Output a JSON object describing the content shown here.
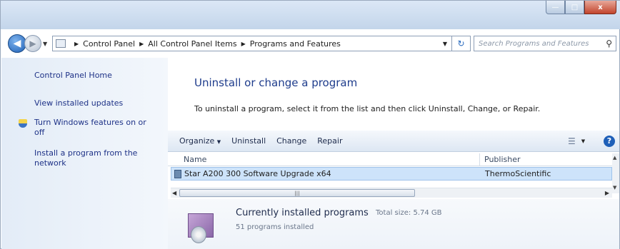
{
  "window": {
    "caption_buttons": {
      "minimize": "—",
      "maximize": "□",
      "close": "x"
    }
  },
  "navigation": {
    "breadcrumbs": [
      "Control Panel",
      "All Control Panel Items",
      "Programs and Features"
    ],
    "search_placeholder": "Search Programs and Features"
  },
  "sidebar": {
    "items": [
      {
        "label": "Control Panel Home"
      },
      {
        "label": "View installed updates"
      },
      {
        "label": "Turn Windows features on or off"
      },
      {
        "label": "Install a program from the network"
      }
    ]
  },
  "main": {
    "title": "Uninstall or change a program",
    "description": "To uninstall a program, select it from the list and then click Uninstall, Change, or Repair."
  },
  "toolbar": {
    "organize": "Organize",
    "uninstall": "Uninstall",
    "change": "Change",
    "repair": "Repair"
  },
  "table": {
    "columns": [
      "Name",
      "Publisher"
    ],
    "rows": [
      {
        "name": "Star A200 300 Software Upgrade x64",
        "publisher": "ThermoScientific"
      }
    ]
  },
  "details": {
    "title": "Currently installed programs",
    "total_size_label": "Total size: 5.74 GB",
    "count_label": "51 programs installed"
  },
  "colors": {
    "accent": "#1e3c8c",
    "selected_row": "#cde3fa"
  }
}
